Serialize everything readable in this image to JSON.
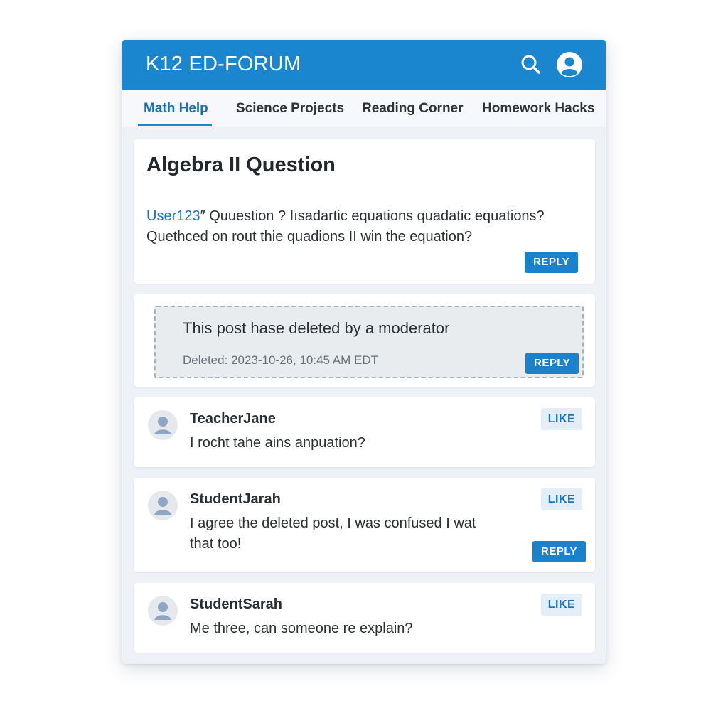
{
  "header": {
    "brand": "K12 ED-FORUM",
    "icons": [
      "search-icon",
      "user-profile-icon"
    ]
  },
  "tabs": [
    {
      "label": "Math Help",
      "active": true
    },
    {
      "label": "Science Projects",
      "active": false
    },
    {
      "label": "Reading Corner",
      "active": false
    },
    {
      "label": "Homework Hacks",
      "active": false
    }
  ],
  "post": {
    "title": "Algebra II Question",
    "author": "User123",
    "body": "″ Quuestion ? Iısadartic equations quadatic equations? Quethced on rout thie quadions II win the equation?",
    "reply_label": "REPLY"
  },
  "deleted_post": {
    "message": "This post hase deleted by a moderator",
    "timestamp": "Deleted: 2023-10-26, 10:45 AM EDT",
    "reply_label": "REPLY"
  },
  "comments": [
    {
      "username": "TeacherJane",
      "text": "I rocht tahe ains anpuation?",
      "like_label": "LIKE",
      "reply_label": ""
    },
    {
      "username": "StudentJarah",
      "text": "I agree the deleted post, I was confused I wat that too!",
      "like_label": "LIKE",
      "reply_label": "REPLY"
    },
    {
      "username": "StudentSarah",
      "text": "Me three, can someone re explain?",
      "like_label": "LIKE",
      "reply_label": ""
    }
  ],
  "colors": {
    "primary": "#1a86d0",
    "app_background": "#eef2f7",
    "avatar": "#8fa6c2"
  }
}
